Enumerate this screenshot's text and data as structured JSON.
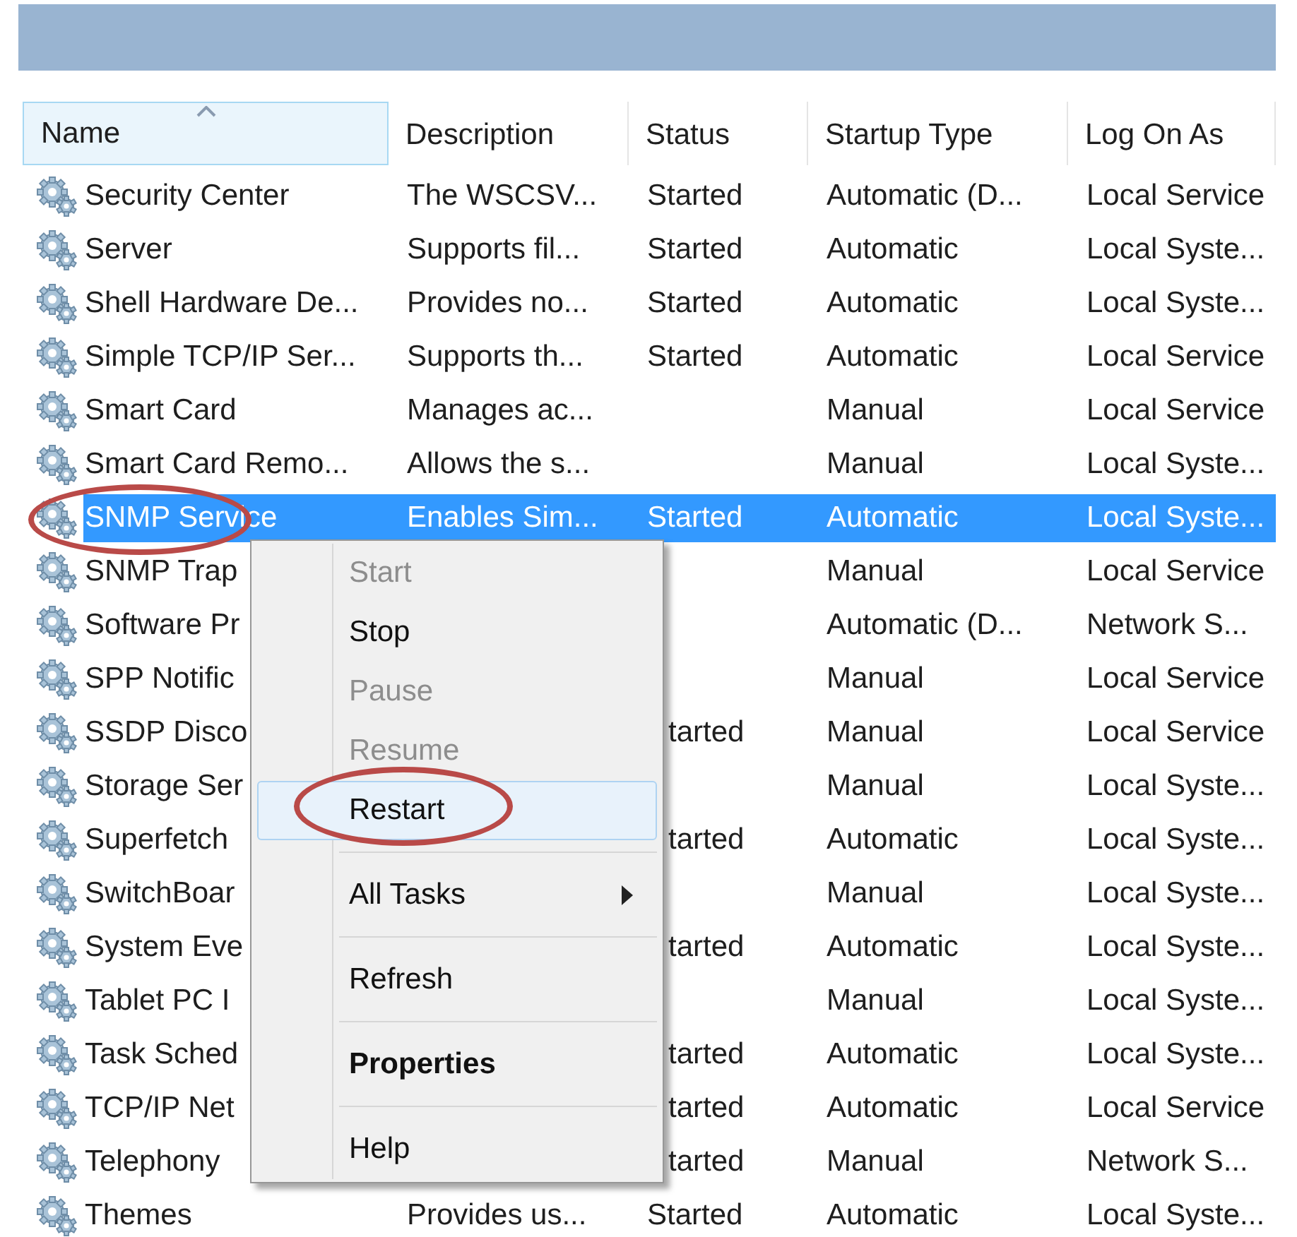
{
  "columns": [
    {
      "label": "Name",
      "sorted": true
    },
    {
      "label": "Description",
      "sorted": false
    },
    {
      "label": "Status",
      "sorted": false
    },
    {
      "label": "Startup Type",
      "sorted": false
    },
    {
      "label": "Log On As",
      "sorted": false
    }
  ],
  "rows": [
    {
      "name": "Security Center",
      "description": "The WSCSV...",
      "status": "Started",
      "startup_type": "Automatic (D...",
      "log_on_as": "Local Service",
      "selected": false
    },
    {
      "name": "Server",
      "description": "Supports fil...",
      "status": "Started",
      "startup_type": "Automatic",
      "log_on_as": "Local Syste...",
      "selected": false
    },
    {
      "name": "Shell Hardware De...",
      "description": "Provides no...",
      "status": "Started",
      "startup_type": "Automatic",
      "log_on_as": "Local Syste...",
      "selected": false
    },
    {
      "name": "Simple TCP/IP Ser...",
      "description": "Supports th...",
      "status": "Started",
      "startup_type": "Automatic",
      "log_on_as": "Local Service",
      "selected": false
    },
    {
      "name": "Smart Card",
      "description": "Manages ac...",
      "startup_type": "Manual",
      "log_on_as": "Local Service",
      "selected": false
    },
    {
      "name": "Smart Card Remo...",
      "description": "Allows the s...",
      "startup_type": "Manual",
      "log_on_as": "Local Syste...",
      "selected": false
    },
    {
      "name": "SNMP Service",
      "description": "Enables Sim...",
      "status": "Started",
      "startup_type": "Automatic",
      "log_on_as": "Local Syste...",
      "selected": true
    },
    {
      "name": "SNMP Trap",
      "startup_type": "Manual",
      "log_on_as": "Local Service",
      "selected": false
    },
    {
      "name": "Software Pr",
      "startup_type": "Automatic (D...",
      "log_on_as": "Network S...",
      "selected": false
    },
    {
      "name": "SPP Notific",
      "startup_type": "Manual",
      "log_on_as": "Local Service",
      "selected": false
    },
    {
      "name": "SSDP Disco",
      "status_fragment": "tarted",
      "startup_type": "Manual",
      "log_on_as": "Local Service",
      "selected": false
    },
    {
      "name": "Storage Ser",
      "startup_type": "Manual",
      "log_on_as": "Local Syste...",
      "selected": false
    },
    {
      "name": "Superfetch",
      "status_fragment": "tarted",
      "startup_type": "Automatic",
      "log_on_as": "Local Syste...",
      "selected": false
    },
    {
      "name": "SwitchBoar",
      "startup_type": "Manual",
      "log_on_as": "Local Syste...",
      "selected": false
    },
    {
      "name": "System Eve",
      "status_fragment": "tarted",
      "startup_type": "Automatic",
      "log_on_as": "Local Syste...",
      "selected": false
    },
    {
      "name": "Tablet PC I",
      "startup_type": "Manual",
      "log_on_as": "Local Syste...",
      "selected": false
    },
    {
      "name": "Task Sched",
      "status_fragment": "tarted",
      "startup_type": "Automatic",
      "log_on_as": "Local Syste...",
      "selected": false
    },
    {
      "name": "TCP/IP Net",
      "status_fragment": "tarted",
      "startup_type": "Automatic",
      "log_on_as": "Local Service",
      "selected": false
    },
    {
      "name": "Telephony",
      "status_fragment": "tarted",
      "startup_type": "Manual",
      "log_on_as": "Network S...",
      "selected": false
    },
    {
      "name": "Themes",
      "description": "Provides us...",
      "status": "Started",
      "startup_type": "Automatic",
      "log_on_as": "Local Syste...",
      "selected": false
    }
  ],
  "context_menu": [
    {
      "kind": "item",
      "label": "Start",
      "disabled": true,
      "selected": false,
      "default": false
    },
    {
      "kind": "item",
      "label": "Stop",
      "disabled": false,
      "selected": false,
      "default": false
    },
    {
      "kind": "item",
      "label": "Pause",
      "disabled": true,
      "selected": false,
      "default": false
    },
    {
      "kind": "item",
      "label": "Resume",
      "disabled": true,
      "selected": false,
      "default": false
    },
    {
      "kind": "item",
      "label": "Restart",
      "disabled": false,
      "selected": true,
      "default": false
    },
    {
      "kind": "separator"
    },
    {
      "kind": "submenu",
      "label": "All Tasks",
      "disabled": false,
      "selected": false,
      "default": false
    },
    {
      "kind": "separator"
    },
    {
      "kind": "item",
      "label": "Refresh",
      "disabled": false,
      "selected": false,
      "default": false
    },
    {
      "kind": "separator"
    },
    {
      "kind": "item",
      "label": "Properties",
      "disabled": false,
      "selected": false,
      "default": true
    },
    {
      "kind": "separator"
    },
    {
      "kind": "item",
      "label": "Help",
      "disabled": false,
      "selected": false,
      "default": false
    }
  ]
}
